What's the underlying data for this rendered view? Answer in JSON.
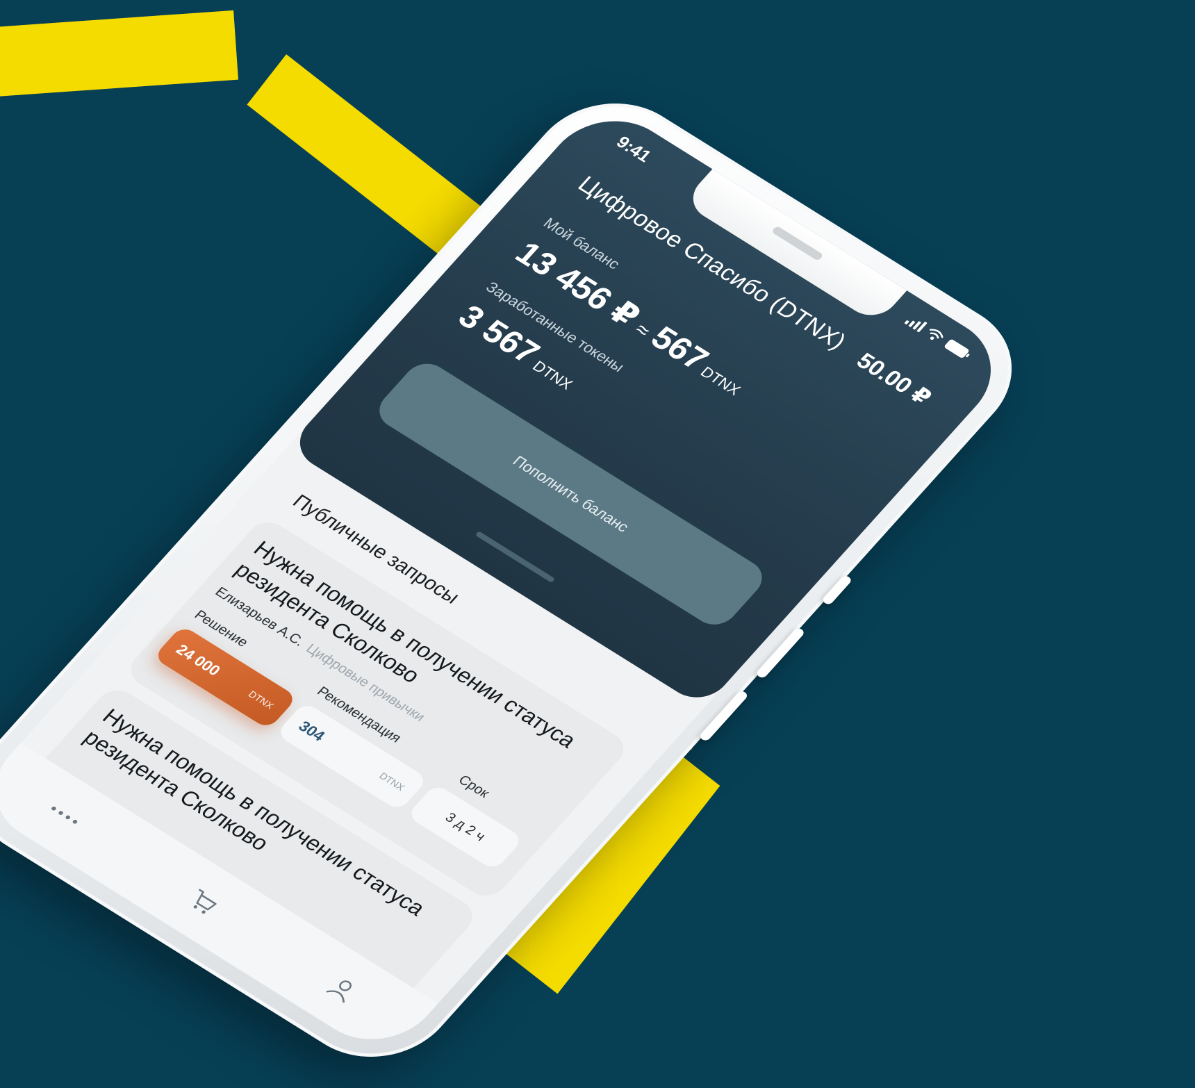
{
  "status_bar": {
    "time": "9:41"
  },
  "header": {
    "app_title": "Цифровое Спасибо (DTNX)",
    "amount": "50.00 ₽",
    "balance_label": "Мой баланс",
    "balance_rub": "13 456 ₽",
    "approx_sign": "≈",
    "balance_tokens": "567",
    "balance_unit": "DTNX",
    "earned_label": "Заработанные токены",
    "earned_tokens": "3 567",
    "earned_unit": "DTNX",
    "topup_button": "Пополнить баланс"
  },
  "requests": {
    "section_title": "Публичные запросы",
    "cards": [
      {
        "title": "Нужна помощь в получении статуса резидента Сколково",
        "author": "Елизарьев А.С.",
        "category": "Цифровые привычки",
        "solution_label": "Решение",
        "solution_value": "24 000",
        "solution_unit": "DTNX",
        "recommend_label": "Рекомендация",
        "recommend_value": "304",
        "recommend_unit": "DTNX",
        "term_label": "Срок",
        "term_value": "3 д 2 ч"
      },
      {
        "title": "Нужна помощь в получении статуса резидента Сколково"
      }
    ]
  },
  "tabbar": {
    "items": [
      "more-icon",
      "cart-icon",
      "profile-icon"
    ]
  },
  "colors": {
    "background": "#073f55",
    "accent_yellow": "#f5dc00",
    "header": "#243b4b",
    "topup_button": "#5c7a86",
    "solution_pill": "#d8692f"
  }
}
